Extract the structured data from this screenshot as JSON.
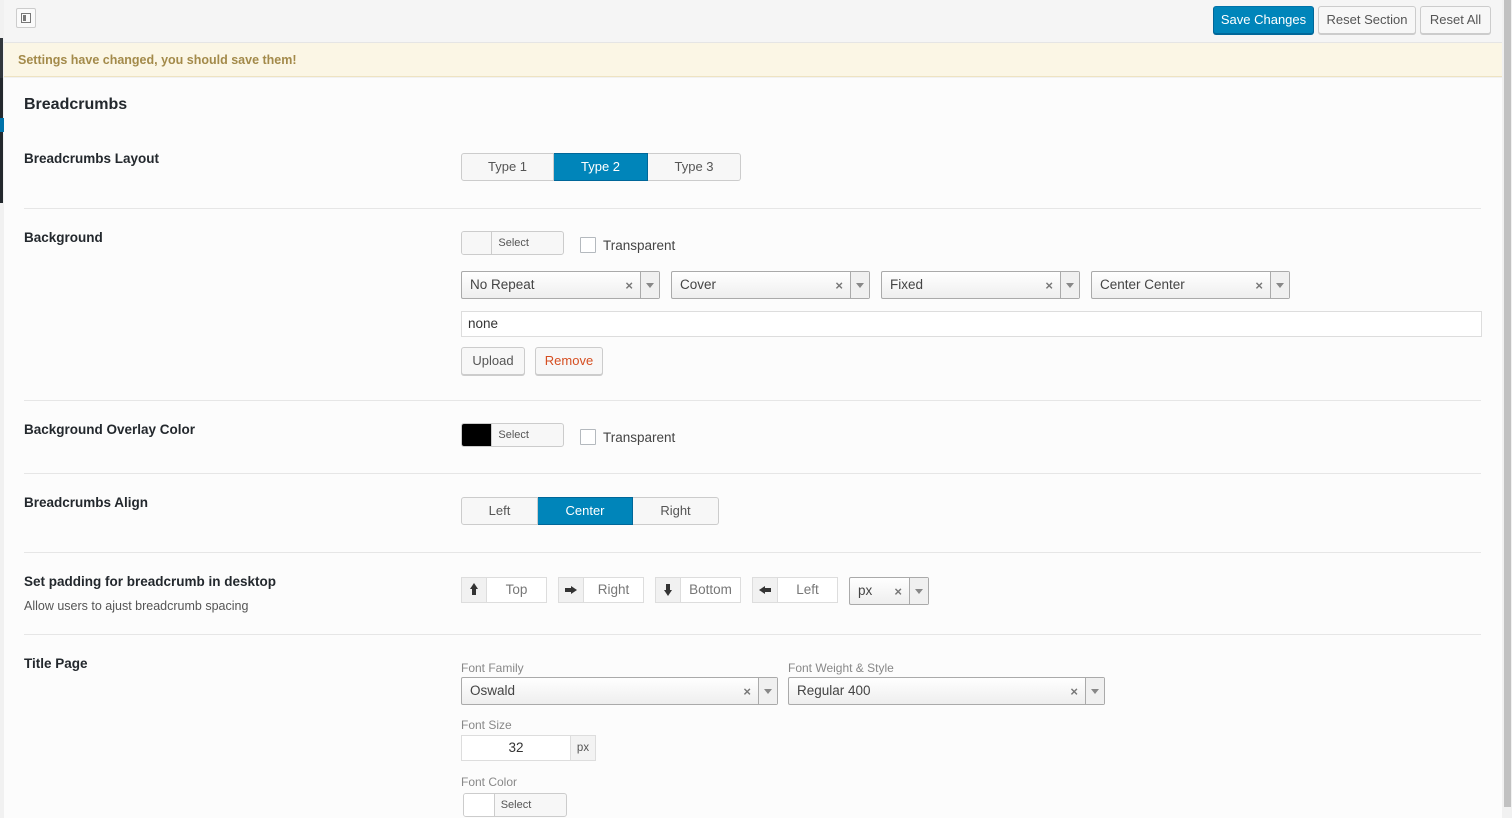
{
  "toolbar": {
    "save_label": "Save Changes",
    "reset_section_label": "Reset Section",
    "reset_all_label": "Reset All"
  },
  "notice": "Settings have changed, you should save them!",
  "section": {
    "title": "Breadcrumbs"
  },
  "layout": {
    "label": "Breadcrumbs Layout",
    "options": [
      "Type 1",
      "Type 2",
      "Type 3"
    ],
    "selected": "Type 2"
  },
  "background": {
    "label": "Background",
    "color_button": "Select Color",
    "transparent_label": "Transparent",
    "transparent_checked": false,
    "repeat": "No Repeat",
    "size": "Cover",
    "attachment": "Fixed",
    "position": "Center Center",
    "image_url": "none",
    "upload_label": "Upload",
    "remove_label": "Remove"
  },
  "overlay": {
    "label": "Background Overlay Color",
    "swatch_color": "#000000",
    "color_button": "Select Color",
    "transparent_label": "Transparent",
    "transparent_checked": false
  },
  "align": {
    "label": "Breadcrumbs Align",
    "options": [
      "Left",
      "Center",
      "Right"
    ],
    "selected": "Center"
  },
  "padding": {
    "label": "Set padding for breadcrumb in desktop",
    "description": "Allow users to ajust breadcrumb spacing",
    "top_placeholder": "Top",
    "right_placeholder": "Right",
    "bottom_placeholder": "Bottom",
    "left_placeholder": "Left",
    "unit": "px"
  },
  "title_page": {
    "label": "Title Page",
    "font_family_label": "Font Family",
    "font_family": "Oswald",
    "font_weight_label": "Font Weight & Style",
    "font_weight": "Regular 400",
    "font_size_label": "Font Size",
    "font_size": "32",
    "font_size_unit": "px",
    "font_color_label": "Font Color",
    "color_button": "Select Color"
  },
  "colors": {
    "primary": "#0085ba",
    "notice_bg": "#fbf6e5",
    "notice_text": "#a38a4a",
    "remove_text": "#d54e21"
  }
}
